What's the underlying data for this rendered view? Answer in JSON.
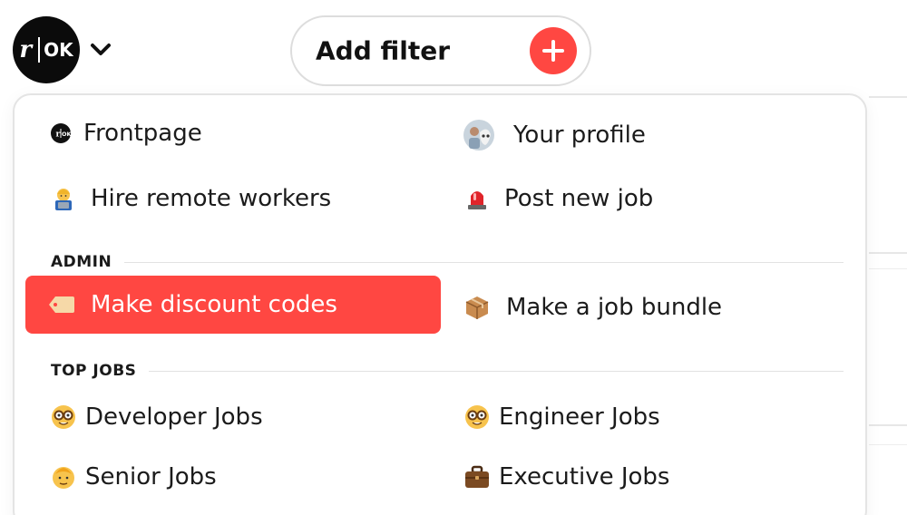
{
  "header": {
    "logo": {
      "left_text": "r",
      "right_text": "OK"
    },
    "add_filter_label": "Add filter"
  },
  "menu": {
    "frontpage": "Frontpage",
    "your_profile": "Your profile",
    "hire_remote_workers": "Hire remote workers",
    "post_new_job": "Post new job",
    "admin_section": "ADMIN",
    "make_discount_codes": "Make discount codes",
    "make_job_bundle": "Make a job bundle",
    "top_jobs_section": "TOP JOBS",
    "developer_jobs": "Developer Jobs",
    "engineer_jobs": "Engineer Jobs",
    "senior_jobs": "Senior Jobs",
    "executive_jobs": "Executive Jobs"
  },
  "colors": {
    "accent": "#ff4742",
    "border": "#e4e4e4"
  },
  "icons": {
    "frontpage": "remoteok-logo-icon",
    "your_profile": "avatar-icon",
    "hire_remote_workers": "technologist-emoji-icon",
    "post_new_job": "siren-emoji-icon",
    "make_discount_codes": "label-tag-emoji-icon",
    "make_job_bundle": "package-emoji-icon",
    "developer_jobs": "nerd-face-emoji-icon",
    "engineer_jobs": "nerd-face-emoji-icon",
    "senior_jobs": "older-person-emoji-icon",
    "executive_jobs": "briefcase-emoji-icon"
  }
}
